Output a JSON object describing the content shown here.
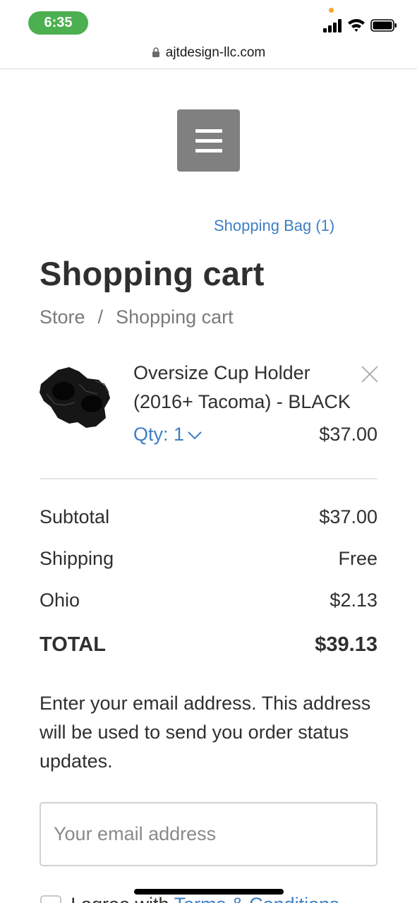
{
  "status_bar": {
    "time": "6:35",
    "signal_icon": "cellular-signal-icon",
    "wifi_icon": "wifi-icon",
    "battery_icon": "battery-icon"
  },
  "browser": {
    "url": "ajtdesign-llc.com",
    "lock_icon": "lock-icon"
  },
  "header": {
    "menu_icon": "hamburger-menu-icon",
    "bag_link": "Shopping Bag (1)"
  },
  "page": {
    "title": "Shopping cart",
    "breadcrumb": [
      "Store",
      "/",
      "Shopping cart"
    ]
  },
  "cart": {
    "items": [
      {
        "name": "Oversize Cup Holder (2016+ Tacoma) - BLACK",
        "qty_label": "Qty: 1",
        "price": "$37.00"
      }
    ]
  },
  "summary": {
    "subtotal_label": "Subtotal",
    "subtotal_value": "$37.00",
    "shipping_label": "Shipping",
    "shipping_value": "Free",
    "tax_label": "Ohio",
    "tax_value": "$2.13",
    "total_label": "TOTAL",
    "total_value": "$39.13"
  },
  "email": {
    "note": "Enter your email address. This address will be used to send you order status updates.",
    "placeholder": "Your email address",
    "value": ""
  },
  "terms": {
    "prefix": "I agree with",
    "link": "Terms & Conditions"
  },
  "colors": {
    "accent": "#3f7fc4",
    "menu_button": "#808080",
    "time_pill": "#4caf50",
    "text": "#2f2f2f"
  }
}
